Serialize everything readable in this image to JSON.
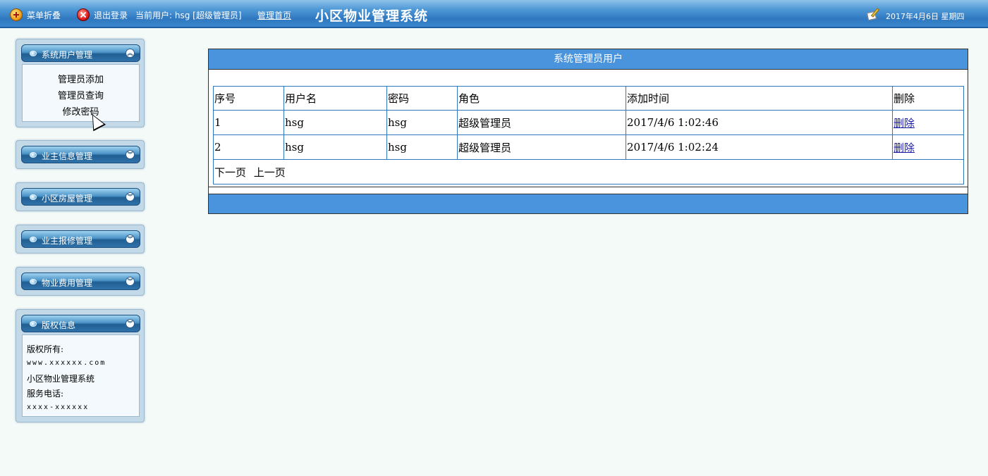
{
  "topbar": {
    "menu_toggle": "菜单折叠",
    "logout": "退出登录",
    "current_user": "当前用户: hsg [超级管理员]",
    "home_link": "管理首页",
    "app_title": "小区物业管理系统",
    "date": "2017年4月6日 星期四"
  },
  "sidebar": {
    "sections": [
      {
        "label": "系统用户管理",
        "items": [
          "管理员添加",
          "管理员查询",
          "修改密码"
        ]
      },
      {
        "label": "业主信息管理"
      },
      {
        "label": "小区房屋管理"
      },
      {
        "label": "业主报修管理"
      },
      {
        "label": "物业费用管理"
      },
      {
        "label": "版权信息"
      }
    ],
    "copyright": {
      "line1": "版权所有:",
      "line2": "www.xxxxxx.com",
      "line3": "小区物业管理系统",
      "line4": "服务电话:",
      "line5": "xxxx-xxxxxx"
    }
  },
  "main": {
    "title": "系统管理员用户",
    "columns": [
      "序号",
      "用户名",
      "密码",
      "角色",
      "添加时间",
      "删除"
    ],
    "rows": [
      {
        "id": "1",
        "username": "hsg",
        "password": "hsg",
        "role": "超级管理员",
        "added": "2017/4/6 1:02:46",
        "delete": "删除"
      },
      {
        "id": "2",
        "username": "hsg",
        "password": "hsg",
        "role": "超级管理员",
        "added": "2017/4/6 1:02:24",
        "delete": "删除"
      }
    ],
    "pager": {
      "next": "下一页",
      "prev": "上一页"
    }
  },
  "colors": {
    "topbar": "#3a86cc",
    "table_header": "#4a94de",
    "grid_border": "#2f78c0",
    "link": "#1a1aa6"
  }
}
